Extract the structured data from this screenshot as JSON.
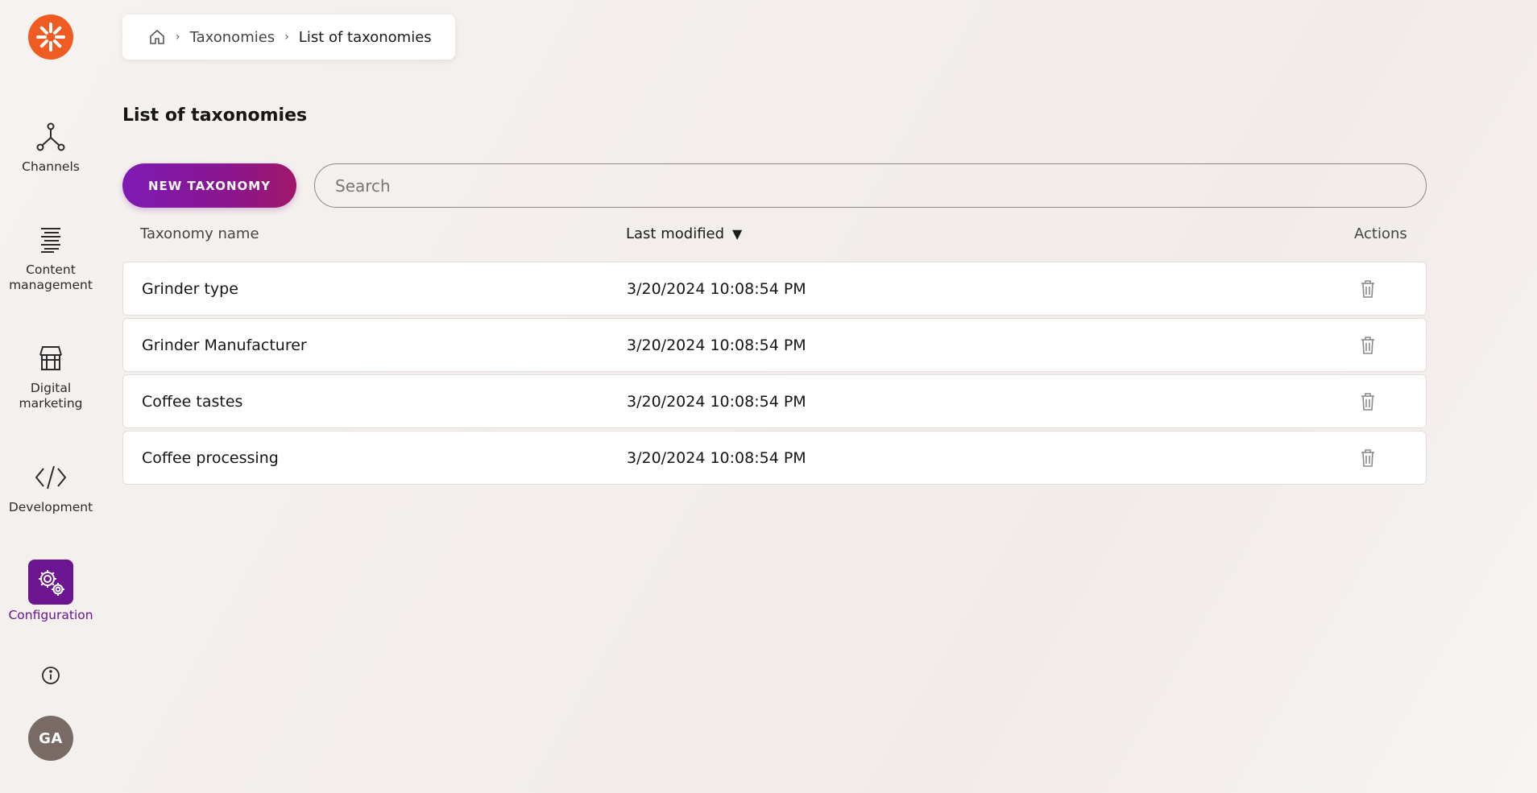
{
  "sidebar": {
    "logo_icon": "kentico-asterisk-logo",
    "items": [
      {
        "label": "Channels",
        "icon": "channels-icon"
      },
      {
        "label": "Content management",
        "icon": "content-management-icon"
      },
      {
        "label": "Digital marketing",
        "icon": "storefront-icon"
      },
      {
        "label": "Development",
        "icon": "code-icon"
      },
      {
        "label": "Configuration",
        "icon": "gears-icon",
        "active": true
      }
    ],
    "info_icon": "info-icon",
    "avatar_initials": "GA"
  },
  "breadcrumb": {
    "home_icon": "home-icon",
    "items": [
      "Taxonomies",
      "List of taxonomies"
    ]
  },
  "page": {
    "title": "List of taxonomies",
    "new_button_label": "NEW TAXONOMY",
    "search_placeholder": "Search"
  },
  "table": {
    "columns": {
      "name": "Taxonomy name",
      "modified": "Last modified",
      "actions": "Actions"
    },
    "sort_indicator": "▼",
    "rows": [
      {
        "name": "Grinder type",
        "modified": "3/20/2024 10:08:54 PM"
      },
      {
        "name": "Grinder Manufacturer",
        "modified": "3/20/2024 10:08:54 PM"
      },
      {
        "name": "Coffee tastes",
        "modified": "3/20/2024 10:08:54 PM"
      },
      {
        "name": "Coffee processing",
        "modified": "3/20/2024 10:08:54 PM"
      }
    ]
  },
  "colors": {
    "brand_orange": "#ef5b23",
    "accent_purple": "#6b1590",
    "button_gradient_start": "#7e1ab4",
    "button_gradient_end": "#a0176a"
  }
}
